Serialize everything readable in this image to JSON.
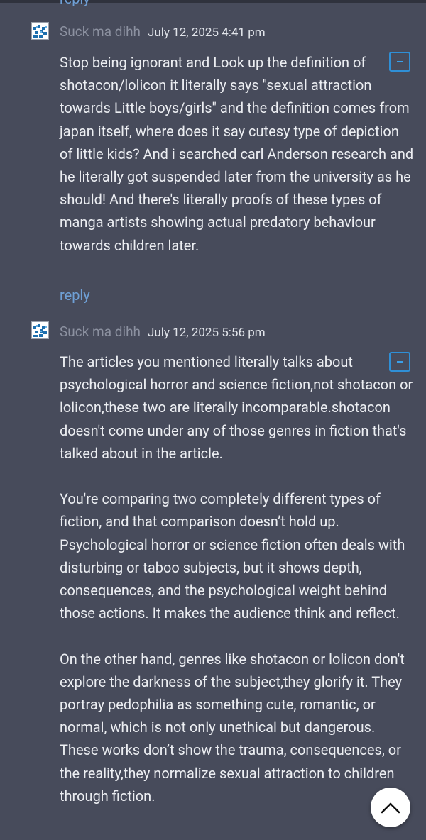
{
  "top_reply_label": "reply",
  "comments": [
    {
      "author": "Suck ma dihh",
      "date": "July 12, 2025 4:41 pm",
      "collapse_label": "-",
      "paragraphs": [
        "Stop being ignorant and Look up the definition of shotacon/lolicon it literally says \"sexual attraction towards Little boys/girls\" and the definition comes from japan itself, where does it say cutesy type of depiction of little kids? And i searched carl Anderson research and he literally got suspended later from the university as he should! And there's literally proofs of these types of manga artists showing actual predatory behaviour towards children later."
      ],
      "reply_label": "reply"
    },
    {
      "author": "Suck ma dihh",
      "date": "July 12, 2025 5:56 pm",
      "collapse_label": "-",
      "paragraphs": [
        "The articles you mentioned literally talks about psychological horror and science fiction,not shotacon or lolicon,these two are literally incomparable.shotacon doesn't come under any of those genres in fiction that's talked about in the article.",
        "You're comparing two completely different types of fiction, and that comparison doesn’t hold up. Psychological horror or science fiction often deals with disturbing or taboo subjects, but it shows depth, consequences, and the psychological weight behind those actions. It makes the audience think and reflect.",
        "On the other hand, genres like shotacon or lolicon don't explore the darkness of the subject,they glorify it. They portray pedophilia as something cute, romantic, or normal, which is not only unethical but dangerous. These works don’t show the trauma, consequences, or the reality,they normalize sexual attraction to children through fiction."
      ]
    }
  ],
  "scroll_top": {
    "icon": "chevron-up-icon"
  },
  "colors": {
    "background": "#474b5b",
    "link": "#6fa0d6",
    "accent": "#2f8fd6",
    "author": "#8c91a0"
  }
}
